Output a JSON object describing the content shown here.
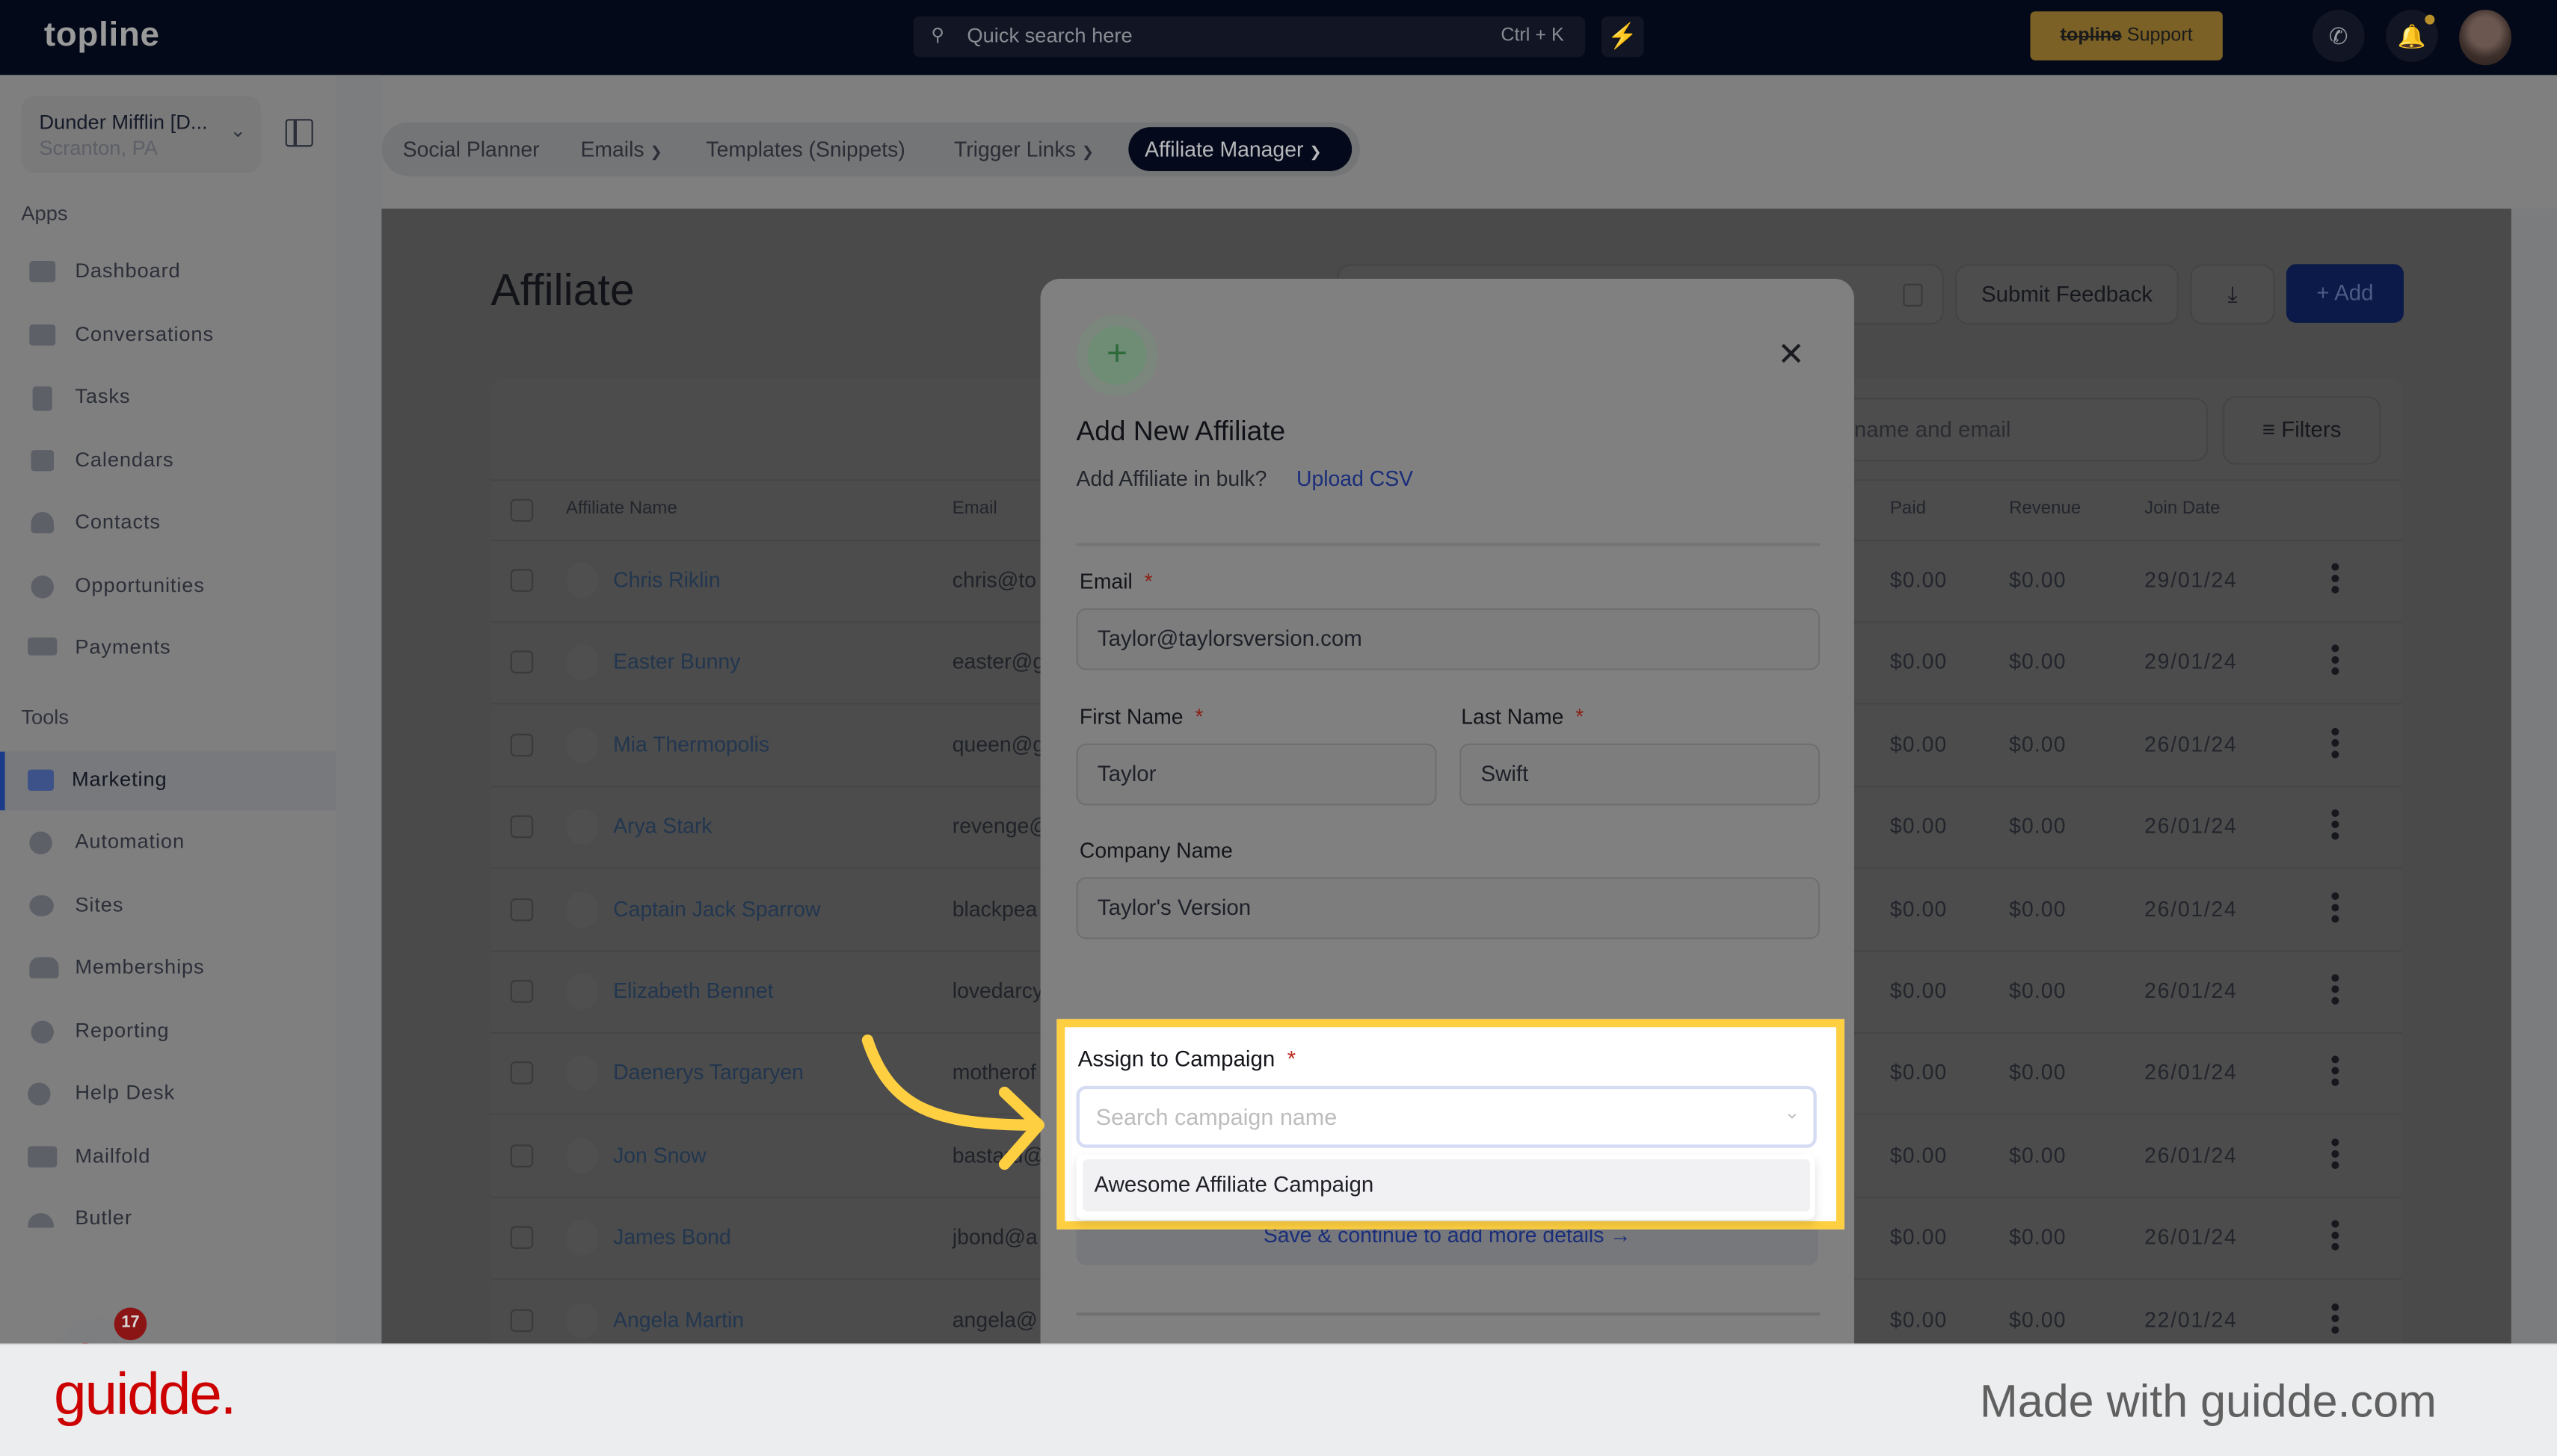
{
  "topbar": {
    "logo": "topline",
    "search_placeholder": "Quick search here",
    "search_shortcut": "Ctrl + K",
    "support_brand": "topline",
    "support_label": " Support"
  },
  "sidebar": {
    "account_name": "Dunder Mifflin [D...",
    "account_location": "Scranton, PA",
    "apps_section": "Apps",
    "apps": [
      {
        "label": "Dashboard",
        "icon": "dashboard-icon"
      },
      {
        "label": "Conversations",
        "icon": "chat-icon"
      },
      {
        "label": "Tasks",
        "icon": "task-icon"
      },
      {
        "label": "Calendars",
        "icon": "calendar-icon"
      },
      {
        "label": "Contacts",
        "icon": "contact-icon"
      },
      {
        "label": "Opportunities",
        "icon": "target-icon"
      },
      {
        "label": "Payments",
        "icon": "card-icon"
      }
    ],
    "tools_section": "Tools",
    "tools": [
      {
        "label": "Marketing",
        "icon": "megaphone-icon",
        "active": true
      },
      {
        "label": "Automation",
        "icon": "gears-icon"
      },
      {
        "label": "Sites",
        "icon": "globe-icon"
      },
      {
        "label": "Memberships",
        "icon": "users-icon"
      },
      {
        "label": "Reporting",
        "icon": "pie-chart-icon"
      },
      {
        "label": "Help Desk",
        "icon": "help-icon"
      },
      {
        "label": "Mailfold",
        "icon": "mail-icon"
      },
      {
        "label": "Butler",
        "icon": "bell-service-icon"
      }
    ],
    "launcher_badge": "17"
  },
  "tabs": [
    {
      "label": "Social Planner",
      "dropdown": false
    },
    {
      "label": "Emails",
      "dropdown": true
    },
    {
      "label": "Templates (Snippets)",
      "dropdown": false
    },
    {
      "label": "Trigger Links",
      "dropdown": true
    },
    {
      "label": "Affiliate Manager",
      "dropdown": true,
      "active": true
    }
  ],
  "page": {
    "title": "Affiliate",
    "submit_feedback": "Submit Feedback",
    "add_label": "Add",
    "search_placeholder_visible": "name and email",
    "filters_label": "Filters"
  },
  "table": {
    "columns": [
      "Affiliate Name",
      "Email",
      "Paid",
      "Revenue",
      "Join Date"
    ],
    "rows": [
      {
        "name": "Chris Riklin",
        "email": "chris@to",
        "paid": "$0.00",
        "revenue": "$0.00",
        "join_date": "29/01/24"
      },
      {
        "name": "Easter Bunny",
        "email": "easter@g",
        "paid": "$0.00",
        "revenue": "$0.00",
        "join_date": "29/01/24"
      },
      {
        "name": "Mia Thermopolis",
        "email": "queen@g",
        "paid": "$0.00",
        "revenue": "$0.00",
        "join_date": "26/01/24"
      },
      {
        "name": "Arya Stark",
        "email": "revenge@",
        "paid": "$0.00",
        "revenue": "$0.00",
        "join_date": "26/01/24"
      },
      {
        "name": "Captain Jack Sparrow",
        "email": "blackpea",
        "paid": "$0.00",
        "revenue": "$0.00",
        "join_date": "26/01/24"
      },
      {
        "name": "Elizabeth Bennet",
        "email": "lovedarcy",
        "paid": "$0.00",
        "revenue": "$0.00",
        "join_date": "26/01/24"
      },
      {
        "name": "Daenerys Targaryen",
        "email": "motherof",
        "paid": "$0.00",
        "revenue": "$0.00",
        "join_date": "26/01/24"
      },
      {
        "name": "Jon Snow",
        "email": "bastard@",
        "paid": "$0.00",
        "revenue": "$0.00",
        "join_date": "26/01/24"
      },
      {
        "name": "James Bond",
        "email": "jbond@a",
        "paid": "$0.00",
        "revenue": "$0.00",
        "join_date": "26/01/24"
      },
      {
        "name": "Angela Martin",
        "email": "angela@",
        "paid": "$0.00",
        "revenue": "$0.00",
        "join_date": "22/01/24"
      }
    ]
  },
  "modal": {
    "title": "Add New Affiliate",
    "bulk_text": "Add Affiliate in bulk?",
    "upload_link": "Upload CSV",
    "email_label": "Email",
    "email_value": "Taylor@taylorsversion.com",
    "first_name_label": "First Name",
    "first_name_value": "Taylor",
    "last_name_label": "Last Name",
    "last_name_value": "Swift",
    "company_label": "Company Name",
    "company_value": "Taylor's Version",
    "campaign_label": "Assign to Campaign",
    "campaign_placeholder": "Search campaign name",
    "campaign_options": [
      "Awesome Affiliate Campaign"
    ],
    "required_mark": "*",
    "save_continue": "Save & continue to add more details →"
  },
  "footer": {
    "brand": "guidde.",
    "made_with": "Made with guidde.com"
  },
  "colors": {
    "highlight": "#fecf41",
    "brand_primary": "#1b3a8a",
    "guidde_red": "#cc0000"
  }
}
